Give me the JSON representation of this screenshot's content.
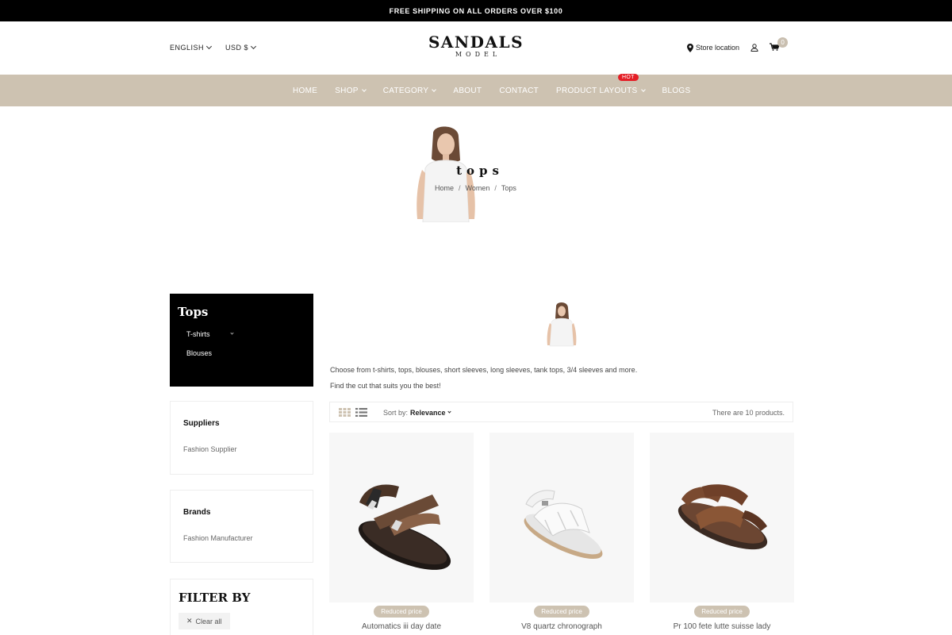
{
  "topbar": {
    "text": "FREE SHIPPING ON ALL ORDERS OVER $100"
  },
  "header": {
    "language": "ENGLISH",
    "currency": "USD $",
    "logo_main": "SANDALS",
    "logo_sub": "MODEL",
    "store_location": "Store location",
    "cart_count": "0"
  },
  "nav": {
    "items": [
      "HOME",
      "SHOP",
      "CATEGORY",
      "ABOUT",
      "CONTACT",
      "PRODUCT LAYOUTS",
      "BLOGS"
    ],
    "hot_badge": "HOT"
  },
  "hero": {
    "title": "tops",
    "breadcrumb": [
      "Home",
      "Women",
      "Tops"
    ]
  },
  "sidebar": {
    "category_title": "Tops",
    "subcategories": [
      "T-shirts",
      "Blouses"
    ],
    "suppliers_title": "Suppliers",
    "supplier_option": "Fashion Supplier",
    "brands_title": "Brands",
    "brand_option": "Fashion Manufacturer",
    "filter_title": "FILTER BY",
    "clear_all": "Clear all"
  },
  "main": {
    "description_1": "Choose from t-shirts, tops, blouses, short sleeves, long sleeves, tank tops, 3/4 sleeves and more.",
    "description_2": "Find the cut that suits you the best!",
    "sort_label": "Sort by:",
    "sort_value": "Relevance",
    "product_count": "There are 10 products."
  },
  "products": [
    {
      "name": "Automatics iii day date",
      "badge": "Reduced price"
    },
    {
      "name": "V8 quartz chronograph",
      "badge": "Reduced price"
    },
    {
      "name": "Pr 100 fete lutte suisse lady",
      "badge": "Reduced price"
    }
  ],
  "colors": {
    "nav_bg": "#cdc2b1",
    "hot": "#e41e26",
    "dark": "#000000"
  }
}
